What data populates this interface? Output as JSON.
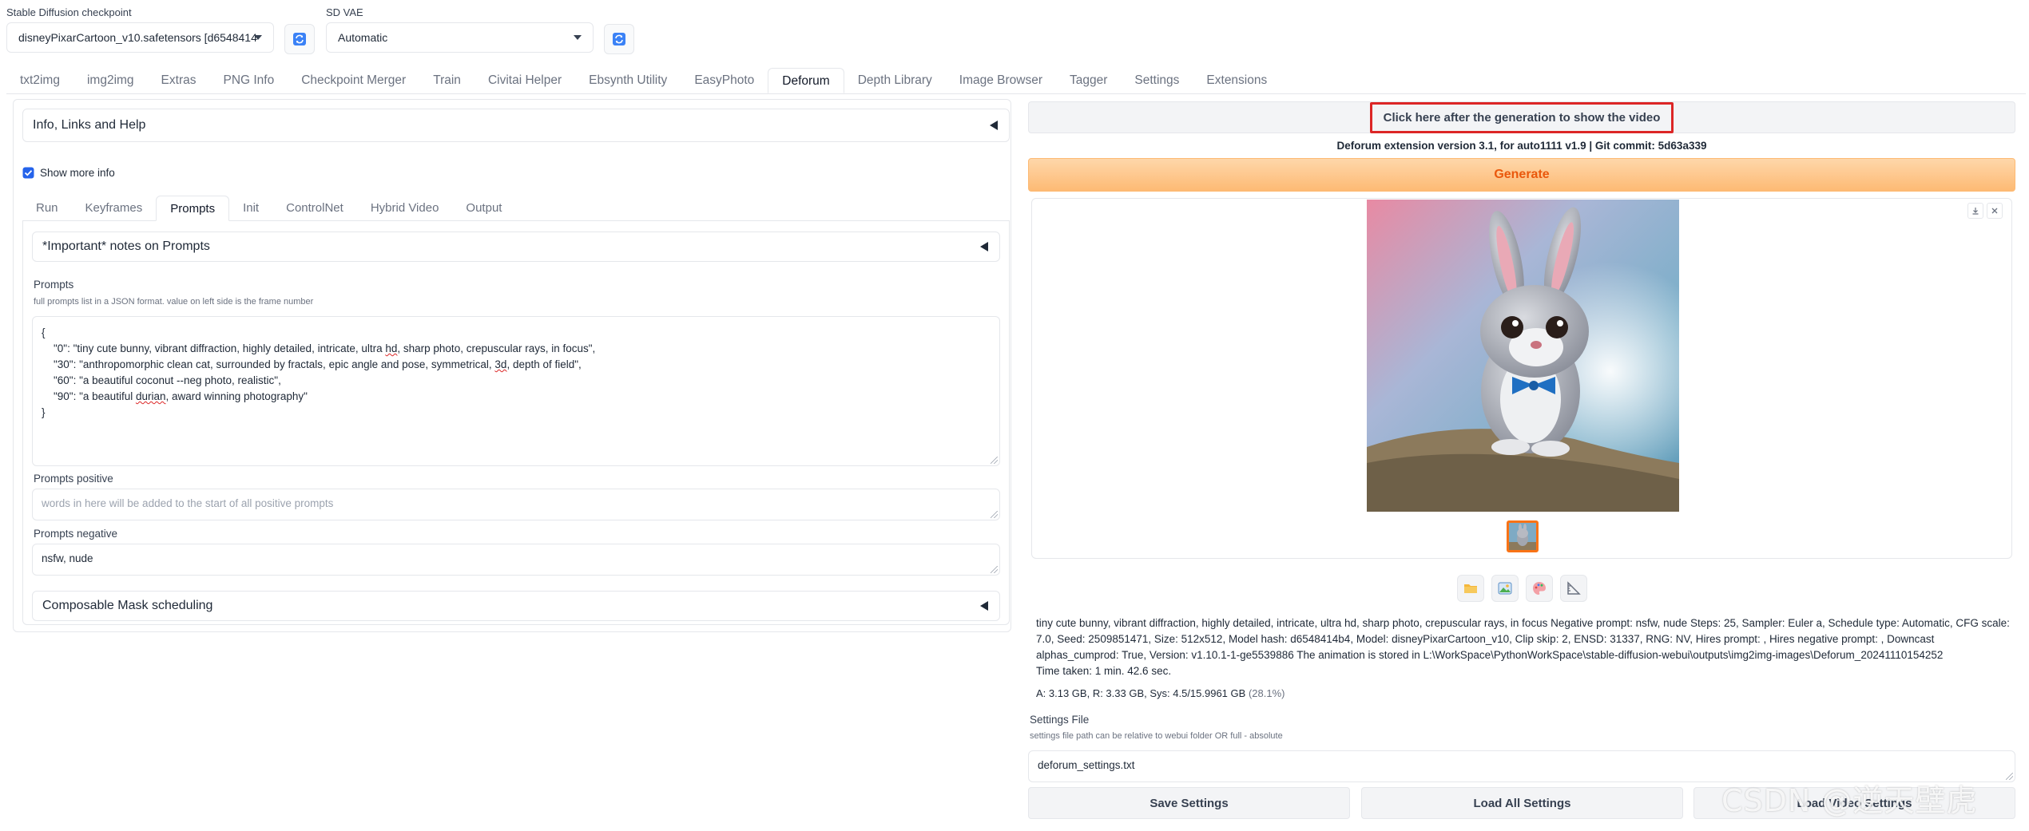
{
  "header": {
    "checkpoint_label": "Stable Diffusion checkpoint",
    "checkpoint_value": "disneyPixarCartoon_v10.safetensors [d6548414",
    "vae_label": "SD VAE",
    "vae_value": "Automatic"
  },
  "main_tabs": [
    {
      "label": "txt2img"
    },
    {
      "label": "img2img"
    },
    {
      "label": "Extras"
    },
    {
      "label": "PNG Info"
    },
    {
      "label": "Checkpoint Merger"
    },
    {
      "label": "Train"
    },
    {
      "label": "Civitai Helper"
    },
    {
      "label": "Ebsynth Utility"
    },
    {
      "label": "EasyPhoto"
    },
    {
      "label": "Deforum"
    },
    {
      "label": "Depth Library"
    },
    {
      "label": "Image Browser"
    },
    {
      "label": "Tagger"
    },
    {
      "label": "Settings"
    },
    {
      "label": "Extensions"
    }
  ],
  "left": {
    "info_accordion": "Info, Links and Help",
    "show_more_info": "Show more info",
    "sub_tabs": [
      {
        "label": "Run"
      },
      {
        "label": "Keyframes"
      },
      {
        "label": "Prompts"
      },
      {
        "label": "Init"
      },
      {
        "label": "ControlNet"
      },
      {
        "label": "Hybrid Video"
      },
      {
        "label": "Output"
      }
    ],
    "notes_accordion": "*Important* notes on Prompts",
    "prompts_label": "Prompts",
    "prompts_help": "full prompts list in a JSON format. value on left side is the frame number",
    "prompts_lines": {
      "l0": "{",
      "l1a": "    \"0\": \"tiny cute bunny, vibrant diffraction, highly detailed, intricate, ultra ",
      "l1b": "hd",
      "l1c": ", sharp photo, crepuscular rays, in focus\",",
      "l2a": "    \"30\": \"anthropomorphic clean cat, surrounded by fractals, epic angle and pose, symmetrical, ",
      "l2b": "3d",
      "l2c": ", depth of field\",",
      "l3": "    \"60\": \"a beautiful coconut --neg photo, realistic\",",
      "l4a": "    \"90\": \"a beautiful ",
      "l4b": "durian",
      "l4c": ", award winning photography\"",
      "l5": "}"
    },
    "positive_label": "Prompts positive",
    "positive_placeholder": "words in here will be added to the start of all positive prompts",
    "negative_label": "Prompts negative",
    "negative_value": "nsfw, nude",
    "mask_accordion": "Composable Mask scheduling"
  },
  "right": {
    "video_button": "Click here after the generation to show the video",
    "version_text": "Deforum extension version 3.1, for auto1111 v1.9 | Git commit: 5d63a339",
    "generate": "Generate",
    "info_text": "tiny cute bunny, vibrant diffraction, highly detailed, intricate, ultra hd, sharp photo, crepuscular rays, in focus Negative prompt: nsfw, nude Steps: 25, Sampler: Euler a, Schedule type: Automatic, CFG scale: 7.0, Seed: 2509851471, Size: 512x512, Model hash: d6548414b4, Model: disneyPixarCartoon_v10, Clip skip: 2, ENSD: 31337, RNG: NV, Hires prompt: , Hires negative prompt: , Downcast alphas_cumprod: True, Version: v1.10.1-1-ge5539886 The animation is stored in L:\\WorkSpace\\PythonWorkSpace\\stable-diffusion-webui\\outputs\\img2img-images\\Deforum_20241110154252",
    "time_taken": "Time taken: 1 min. 42.6 sec.",
    "vram_a": "A: 3.13 GB, R: 3.33 GB, Sys: 4.5/15.9961 GB",
    "vram_pct": "(28.1%)",
    "settings_label": "Settings File",
    "settings_help": "settings file path can be relative to webui folder OR full - absolute",
    "settings_value": "deforum_settings.txt",
    "save_settings": "Save Settings",
    "load_all_settings": "Load All Settings",
    "load_video_settings": "Load Video Settings",
    "watermark": "CSDN @逆天壁虎"
  },
  "colors": {
    "accent": "#f97316",
    "generate_bg": "#fed7aa",
    "highlight_border": "#dc2626",
    "checkbox": "#2563eb",
    "refresh_icon": "#3b82f6"
  },
  "icons": [
    "refresh-icon",
    "collapse-triangle-icon",
    "download-icon",
    "close-icon",
    "folder-icon",
    "image-icon",
    "palette-icon",
    "ruler-icon",
    "checkbox-checked-icon"
  ]
}
